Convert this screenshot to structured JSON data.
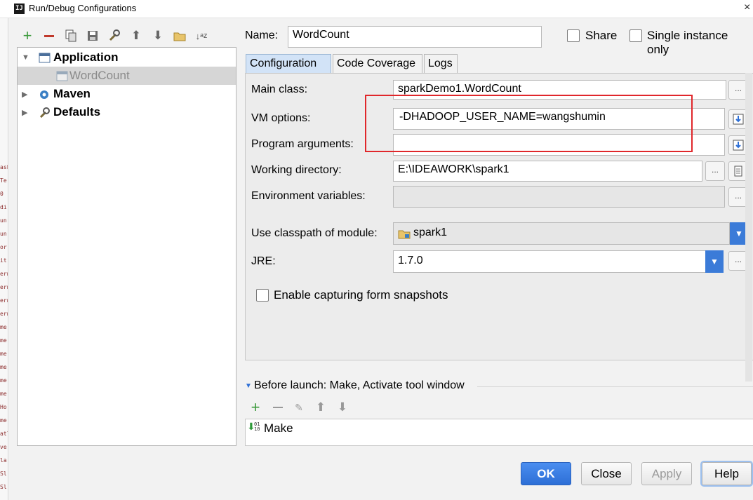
{
  "window": {
    "title": "Run/Debug Configurations",
    "icon": "IJ",
    "close": "×"
  },
  "background_strip": [
    "ask",
    "Te",
    "0",
    "di",
    "un",
    "un",
    "or",
    "it",
    "ern",
    "ern",
    "ern",
    "ern",
    "me",
    "me",
    "me",
    "me",
    "me",
    "me",
    "Ho",
    "mer",
    "atl",
    "ve",
    "la",
    "Sl",
    "Sl"
  ],
  "toolbar": {
    "icons": [
      "add-icon",
      "remove-icon",
      "copy-icon",
      "save-icon",
      "edit-defaults-icon",
      "move-up-icon",
      "move-down-icon",
      "folder-icon",
      "sort-icon"
    ]
  },
  "tree": {
    "items": [
      {
        "label": "Application",
        "expanded": true
      },
      {
        "label": "WordCount",
        "child": true
      },
      {
        "label": "Maven",
        "expanded": false
      },
      {
        "label": "Defaults",
        "expanded": false
      }
    ]
  },
  "name_field": {
    "label": "Name:",
    "value": "WordCount"
  },
  "options": {
    "share": "Share",
    "single_instance": "Single instance only"
  },
  "tabs": [
    "Configuration",
    "Code Coverage",
    "Logs"
  ],
  "form": {
    "main_class": {
      "label": "Main class:",
      "value": "sparkDemo1.WordCount"
    },
    "vm_options": {
      "label": "VM options:",
      "value": "-DHADOOP_USER_NAME=wangshumin"
    },
    "program_args": {
      "label": "Program arguments:",
      "value": ""
    },
    "working_dir": {
      "label": "Working directory:",
      "value": "E:\\IDEAWORK\\spark1"
    },
    "env_vars": {
      "label": "Environment variables:",
      "value": ""
    },
    "classpath": {
      "label": "Use classpath of module:",
      "value": "spark1"
    },
    "jre": {
      "label": "JRE:",
      "value": "1.7.0"
    },
    "form_snapshots": "Enable capturing form snapshots",
    "ellipsis": "..."
  },
  "before_launch": {
    "header": "Before launch: Make, Activate tool window",
    "item": "Make"
  },
  "buttons": {
    "ok": "OK",
    "close": "Close",
    "apply": "Apply",
    "help": "Help"
  },
  "colors": {
    "accent": "#2d6fd6",
    "highlight": "#e0272b",
    "selected_row": "#d6d6d6"
  }
}
